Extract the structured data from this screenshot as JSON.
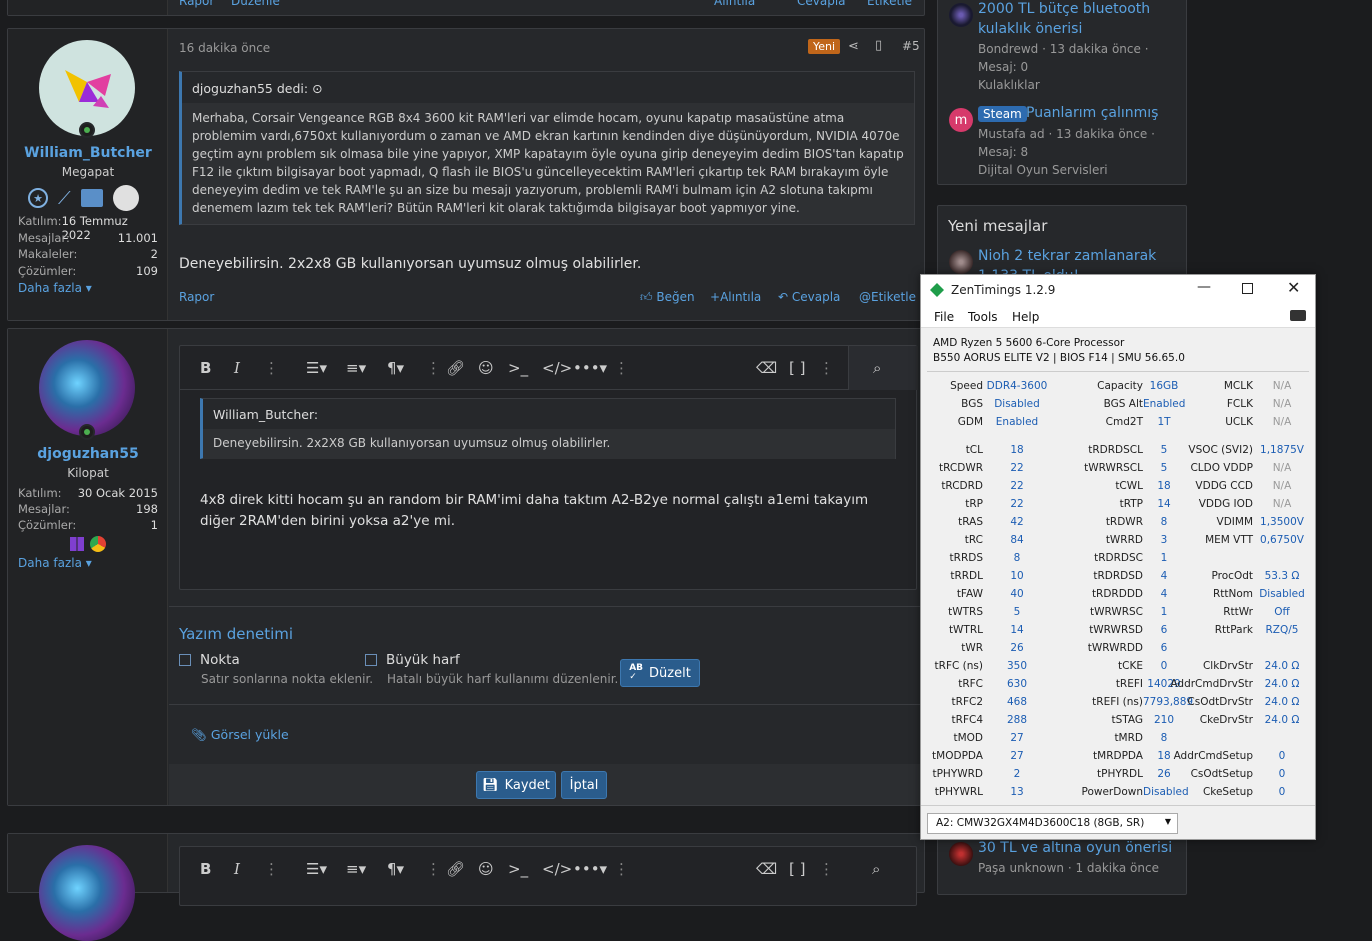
{
  "post1": {
    "author": "William_Butcher",
    "title": "Megapat",
    "stats": [
      {
        "label": "Katılım:",
        "value": "16 Temmuz 2022"
      },
      {
        "label": "Mesajlar:",
        "value": "11.001"
      },
      {
        "label": "Makaleler:",
        "value": "2"
      },
      {
        "label": "Çözümler:",
        "value": "109"
      }
    ],
    "more": "Daha fazla",
    "time": "16 dakika önce",
    "badge": "Yeni",
    "number": "#5",
    "quote_author": "djoguzhan55 dedi:",
    "quote_text": "Merhaba, Corsair Vengeance RGB 8x4 3600 kit RAM'leri var elimde hocam, oyunu kapatıp masaüstüne atma problemim vardı,6750xt kullanıyordum o zaman ve AMD ekran kartının kendinden diye düşünüyordum, NVIDIA 4070e geçtim aynı problem sık olmasa bile yine yapıyor, XMP kapatayım öyle oyuna girip deneyeyim dedim BIOS'tan kapatıp F12 ile çıktım bilgisayar boot yapmadı, Q flash ile BIOS'u güncelleyecektim RAM'leri çıkartıp tek RAM bırakayım öyle deneyeyim dedim ve tek RAM'le şu an size bu mesajı yazıyorum, problemli RAM'i bulmam için A2 slotuna takıpmı denemem lazım tek tek RAM'leri? Bütün RAM'leri kit olarak taktığımda bilgisayar boot yapmıyor yine.",
    "body": "Deneyebilirsin. 2x2x8 GB kullanıyorsan uyumsuz olmuş olabilirler.",
    "report": "Rapor",
    "like": "Beğen",
    "quote": "Alıntıla",
    "reply": "Cevapla",
    "tag": "Etiketle",
    "top_report": "Rapor",
    "top_edit": "Düzenle",
    "top_quote": "Alıntıla",
    "top_reply": "Cevapla",
    "top_tag": "Etiketle"
  },
  "post2": {
    "author": "djoguzhan55",
    "title": "Kilopat",
    "stats": [
      {
        "label": "Katılım:",
        "value": "30 Ocak 2015"
      },
      {
        "label": "Mesajlar:",
        "value": "198"
      },
      {
        "label": "Çözümler:",
        "value": "1"
      }
    ],
    "more": "Daha fazla",
    "editor_quote_author": "William_Butcher:",
    "editor_quote_text": "Deneyebilirsin. 2x2X8 GB kullanıyorsan uyumsuz olmuş olabilirler.",
    "editor_text": "4x8 direk kitti hocam şu an random bir RAM'imi daha taktım A2-B2ye normal çalıştı a1emi takayım diğer 2RAM'den birini yoksa a2'ye mi.",
    "spell_title": "Yazım denetimi",
    "opt1_label": "Nokta",
    "opt1_desc": "Satır sonlarına nokta eklenir.",
    "opt2_label": "Büyük harf",
    "opt2_desc": "Hatalı büyük harf kullanımı düzenlenir.",
    "fix_button": "Düzelt",
    "upload": "Görsel yükle",
    "save": "Kaydet",
    "cancel": "İptal"
  },
  "sidebar": {
    "thread1_title": "2000 TL bütçe bluetooth kulaklık önerisi",
    "thread1_meta": "Bondrewd · 13 dakika önce ·",
    "thread1_meta2": "Mesaj: 0",
    "thread1_forum": "Kulaklıklar",
    "thread2_prefix": "Steam",
    "thread2_title": "Puanlarım çalınmış",
    "thread2_meta": "Mustafa ad · 13 dakika önce ·",
    "thread2_meta2": "Mesaj: 8",
    "thread2_forum": "Dijital Oyun Servisleri",
    "thread2_avatar": "m",
    "new_title": "Yeni mesajlar",
    "new1_title": "Nioh 2 tekrar zamlanarak",
    "new1_sub": "1.133 TL oldu!",
    "new2_title": "30 TL ve altına oyun önerisi",
    "new2_meta": "Paşa unknown · 1 dakika önce"
  },
  "zentimings": {
    "title": "ZenTimings 1.2.9",
    "menu": [
      "File",
      "Tools",
      "Help"
    ],
    "cpu": "AMD Ryzen 5 5600 6-Core Processor",
    "board": "B550 AORUS ELITE V2 | BIOS F14 | SMU 56.65.0",
    "top": [
      [
        "Speed",
        "DDR4-3600",
        "Capacity",
        "16GB",
        "MCLK",
        "N/A"
      ],
      [
        "BGS",
        "Disabled",
        "BGS Alt",
        "Enabled",
        "FCLK",
        "N/A"
      ],
      [
        "GDM",
        "Enabled",
        "Cmd2T",
        "1T",
        "UCLK",
        "N/A"
      ]
    ],
    "timings": [
      [
        "tCL",
        "18",
        "tRDRDSCL",
        "5",
        "VSOC (SVI2)",
        "1,1875V"
      ],
      [
        "tRCDWR",
        "22",
        "tWRWRSCL",
        "5",
        "CLDO VDDP",
        "N/A"
      ],
      [
        "tRCDRD",
        "22",
        "tCWL",
        "18",
        "VDDG CCD",
        "N/A"
      ],
      [
        "tRP",
        "22",
        "tRTP",
        "14",
        "VDDG IOD",
        "N/A"
      ],
      [
        "tRAS",
        "42",
        "tRDWR",
        "8",
        "VDIMM",
        "1,3500V"
      ],
      [
        "tRC",
        "84",
        "tWRRD",
        "3",
        "MEM VTT",
        "0,6750V"
      ],
      [
        "tRRDS",
        "8",
        "tRDRDSC",
        "1",
        "",
        ""
      ],
      [
        "tRRDL",
        "10",
        "tRDRDSD",
        "4",
        "ProcOdt",
        "53.3 Ω"
      ],
      [
        "tFAW",
        "40",
        "tRDRDDD",
        "4",
        "RttNom",
        "Disabled"
      ],
      [
        "tWTRS",
        "5",
        "tWRWRSC",
        "1",
        "RttWr",
        "Off"
      ],
      [
        "tWTRL",
        "14",
        "tWRWRSD",
        "6",
        "RttPark",
        "RZQ/5"
      ],
      [
        "tWR",
        "26",
        "tWRWRDD",
        "6",
        "",
        ""
      ],
      [
        "tRFC (ns)",
        "350",
        "tCKE",
        "0",
        "ClkDrvStr",
        "24.0 Ω"
      ],
      [
        "tRFC",
        "630",
        "tREFI",
        "14029",
        "AddrCmdDrvStr",
        "24.0 Ω"
      ],
      [
        "tRFC2",
        "468",
        "tREFI (ns)",
        "7793,889",
        "CsOdtDrvStr",
        "24.0 Ω"
      ],
      [
        "tRFC4",
        "288",
        "tSTAG",
        "210",
        "CkeDrvStr",
        "24.0 Ω"
      ],
      [
        "tMOD",
        "27",
        "tMRD",
        "8",
        "",
        ""
      ],
      [
        "tMODPDA",
        "27",
        "tMRDPDA",
        "18",
        "AddrCmdSetup",
        "0"
      ],
      [
        "tPHYWRD",
        "2",
        "tPHYRDL",
        "26",
        "CsOdtSetup",
        "0"
      ],
      [
        "tPHYWRL",
        "13",
        "PowerDown",
        "Disabled",
        "CkeSetup",
        "0"
      ]
    ],
    "dimm": "A2: CMW32GX4M4D3600C18 (8GB, SR)"
  }
}
